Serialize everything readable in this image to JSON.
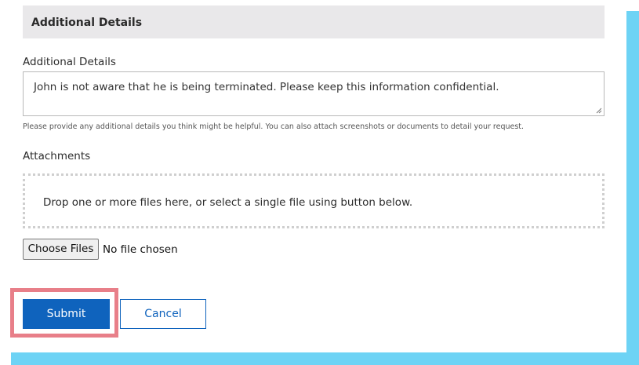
{
  "section": {
    "title": "Additional Details"
  },
  "details_field": {
    "label": "Additional Details",
    "value": "John is not aware that he is being terminated. Please keep this information confidential.",
    "help": "Please provide any additional details you think might be helpful. You can also attach screenshots or documents to detail your request."
  },
  "attachments": {
    "label": "Attachments",
    "dropzone_text": "Drop one or more files here, or select a single file using button below.",
    "choose_label": "Choose Files",
    "status_text": "No file chosen"
  },
  "actions": {
    "submit_label": "Submit",
    "cancel_label": "Cancel"
  },
  "colors": {
    "primary": "#0f63bd",
    "highlight": "#e87f89",
    "frame": "#6dd3f5",
    "header_bg": "#e9e8ea"
  }
}
